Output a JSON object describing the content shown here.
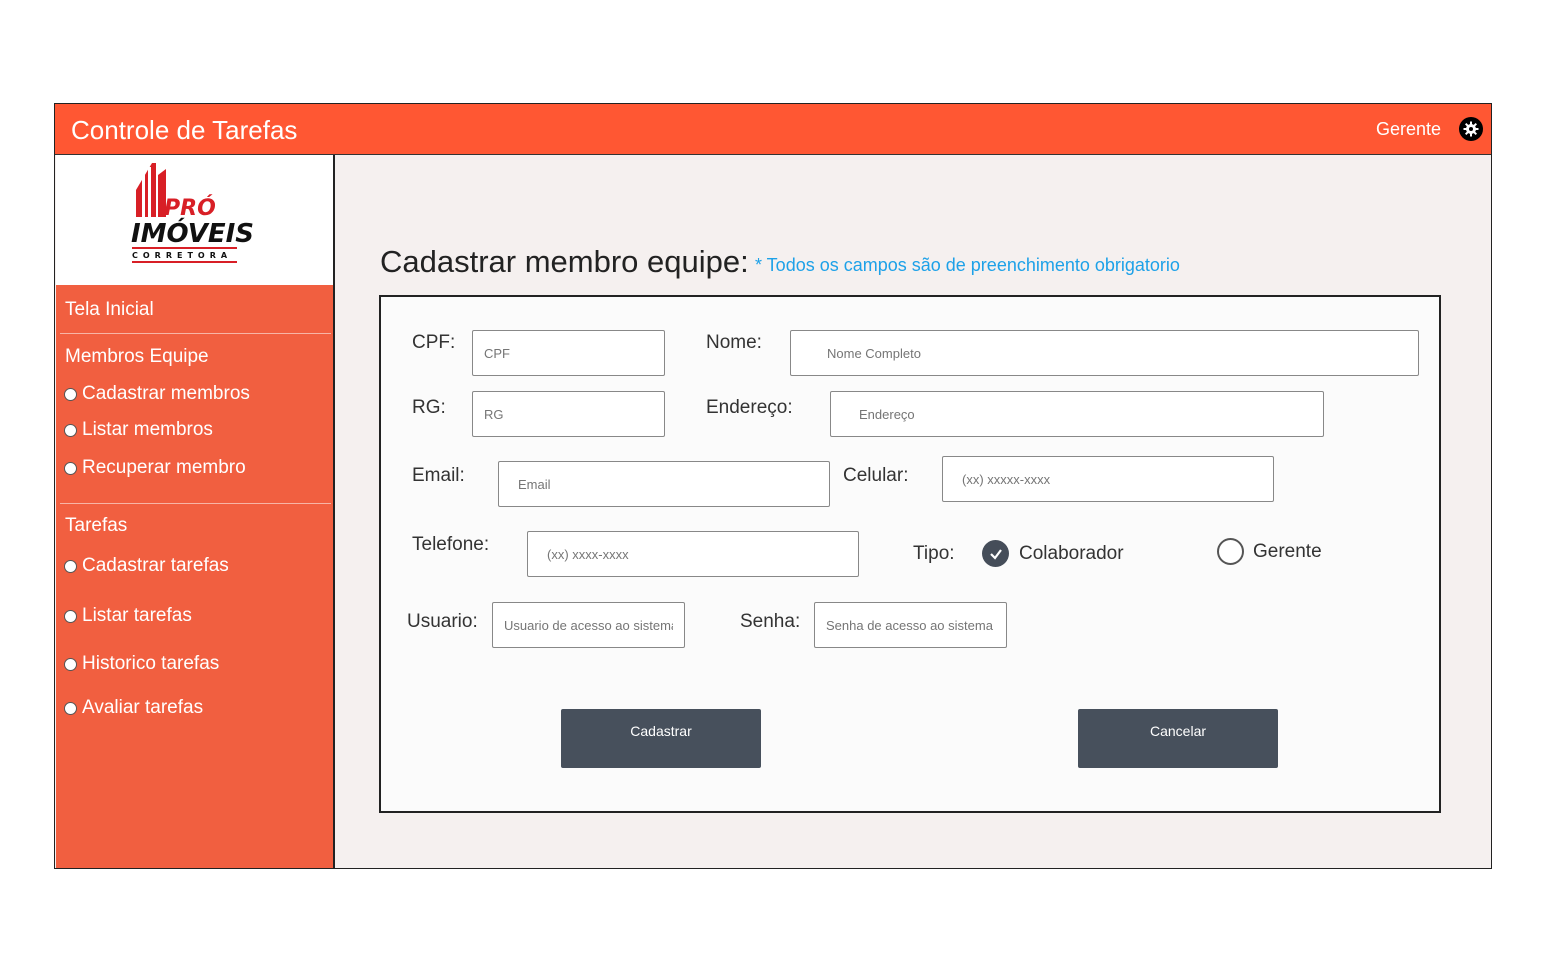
{
  "header": {
    "title": "Controle de Tarefas",
    "user": "Gerente",
    "settings_icon": "gear-icon"
  },
  "logo": {
    "line1": "PRÓ",
    "line2": "IMÓVEIS",
    "line3": "CORRETORA"
  },
  "sidebar": {
    "home": "Tela Inicial",
    "members_section": "Membros Equipe",
    "members_items": [
      "Cadastrar membros",
      "Listar membros",
      "Recuperar membro"
    ],
    "tasks_section": "Tarefas",
    "tasks_items": [
      "Cadastrar tarefas",
      "Listar tarefas",
      "Historico tarefas",
      "Avaliar tarefas"
    ]
  },
  "page": {
    "title": "Cadastrar membro equipe:",
    "note": "* Todos os campos são de preenchimento obrigatorio"
  },
  "form": {
    "cpf": {
      "label": "CPF:",
      "placeholder": "CPF"
    },
    "nome": {
      "label": "Nome:",
      "placeholder": "Nome Completo"
    },
    "rg": {
      "label": "RG:",
      "placeholder": "RG"
    },
    "endereco": {
      "label": "Endereço:",
      "placeholder": "Endereço"
    },
    "email": {
      "label": "Email:",
      "placeholder": "Email"
    },
    "celular": {
      "label": "Celular:",
      "placeholder": "(xx) xxxxx-xxxx"
    },
    "telefone": {
      "label": "Telefone:",
      "placeholder": "(xx) xxxx-xxxx"
    },
    "tipo": {
      "label": "Tipo:",
      "options": [
        "Colaborador",
        "Gerente"
      ],
      "selected": "Colaborador"
    },
    "usuario": {
      "label": "Usuario:",
      "placeholder": "Usuario de acesso ao sistema"
    },
    "senha": {
      "label": "Senha:",
      "placeholder": "Senha de acesso ao sistema"
    },
    "submit": "Cadastrar",
    "cancel": "Cancelar"
  },
  "colors": {
    "header": "#ff5733",
    "sidebar": "#f15f40",
    "note": "#1da1e8",
    "button": "#47505c"
  }
}
